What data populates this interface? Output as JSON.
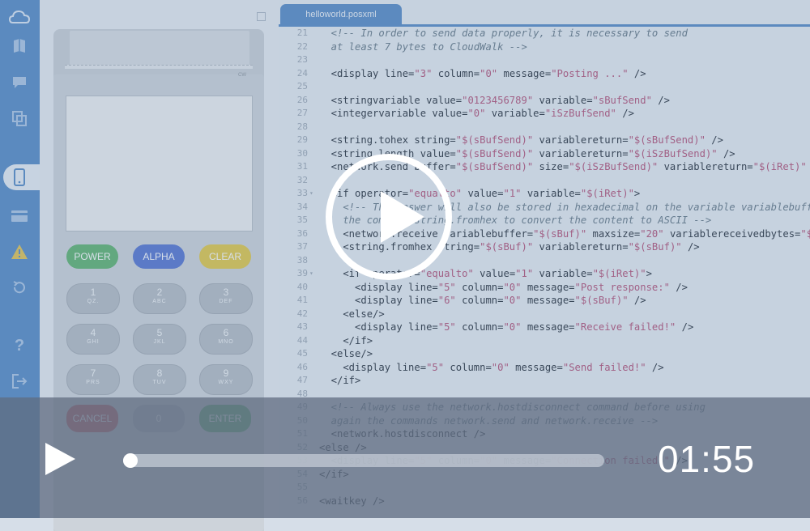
{
  "sidebar": {
    "icons": [
      "cloud-icon",
      "book-icon",
      "chat-icon",
      "copy-icon",
      "device-icon",
      "card-icon",
      "warning-icon",
      "history-icon",
      "help-icon",
      "logout-icon"
    ],
    "active": "device-icon",
    "color": "#4e86c4"
  },
  "terminal": {
    "brand": "CW",
    "function_keys": [
      {
        "label": "POWER",
        "color": "#58b069"
      },
      {
        "label": "ALPHA",
        "color": "#4e6fd0"
      },
      {
        "label": "CLEAR",
        "color": "#e3c73f"
      }
    ],
    "keypad": [
      {
        "digit": "1",
        "letters": "QZ."
      },
      {
        "digit": "2",
        "letters": "ABC"
      },
      {
        "digit": "3",
        "letters": "DEF"
      },
      {
        "digit": "4",
        "letters": "GHI"
      },
      {
        "digit": "5",
        "letters": "JKL"
      },
      {
        "digit": "6",
        "letters": "MNO"
      },
      {
        "digit": "7",
        "letters": "PRS"
      },
      {
        "digit": "8",
        "letters": "TUV"
      },
      {
        "digit": "9",
        "letters": "WXY"
      }
    ],
    "bottom_keys": [
      {
        "label": "CANCEL",
        "color": "#c8575c"
      },
      {
        "label": "0",
        "color": "#b4bbc3"
      },
      {
        "label": "ENTER",
        "color": "#58b069"
      }
    ]
  },
  "editor": {
    "tab_label": "helloworld.posxml",
    "lines": [
      {
        "n": "21",
        "t": "  <!-- In order to send data properly, it is necessary to send",
        "fold": ""
      },
      {
        "n": "22",
        "t": "  at least 7 bytes to CloudWalk -->",
        "fold": ""
      },
      {
        "n": "23",
        "t": "",
        "fold": ""
      },
      {
        "n": "24",
        "t": "  <display line=\"3\" column=\"0\" message=\"Posting ...\" />",
        "fold": ""
      },
      {
        "n": "25",
        "t": "",
        "fold": ""
      },
      {
        "n": "26",
        "t": "  <stringvariable value=\"0123456789\" variable=\"sBufSend\" />",
        "fold": ""
      },
      {
        "n": "27",
        "t": "  <integervariable value=\"0\" variable=\"iSzBufSend\" />",
        "fold": ""
      },
      {
        "n": "28",
        "t": "",
        "fold": ""
      },
      {
        "n": "29",
        "t": "  <string.tohex string=\"$(sBufSend)\" variablereturn=\"$(sBufSend)\" />",
        "fold": ""
      },
      {
        "n": "30",
        "t": "  <string.length value=\"$(sBufSend)\" variablereturn=\"$(iSzBufSend)\" />",
        "fold": ""
      },
      {
        "n": "31",
        "t": "  <network.send buffer=\"$(sBufSend)\" size=\"$(iSzBufSend)\" variablereturn=\"$(iRet)\" />",
        "fold": ""
      },
      {
        "n": "32",
        "t": "",
        "fold": ""
      },
      {
        "n": "33",
        "t": "  <if operator=\"equalto\" value=\"1\" variable=\"$(iRet)\">",
        "fold": "▾"
      },
      {
        "n": "34",
        "t": "    <!-- The answer will also be stored in hexadecimal on the variable variablebuffer, use",
        "fold": ""
      },
      {
        "n": "35",
        "t": "    the command string.fromhex to convert the content to ASCII -->",
        "fold": ""
      },
      {
        "n": "36",
        "t": "    <network.receive variablebuffer=\"$(sBuf)\" maxsize=\"20\" variablereceivedbytes=\"$(iRet)\" />",
        "fold": ""
      },
      {
        "n": "37",
        "t": "    <string.fromhex string=\"$(sBuf)\" variablereturn=\"$(sBuf)\" />",
        "fold": ""
      },
      {
        "n": "38",
        "t": "",
        "fold": ""
      },
      {
        "n": "39",
        "t": "    <if operator=\"equalto\" value=\"1\" variable=\"$(iRet)\">",
        "fold": "▾"
      },
      {
        "n": "40",
        "t": "      <display line=\"5\" column=\"0\" message=\"Post response:\" />",
        "fold": ""
      },
      {
        "n": "41",
        "t": "      <display line=\"6\" column=\"0\" message=\"$(sBuf)\" />",
        "fold": ""
      },
      {
        "n": "42",
        "t": "    <else/>",
        "fold": ""
      },
      {
        "n": "43",
        "t": "      <display line=\"5\" column=\"0\" message=\"Receive failed!\" />",
        "fold": ""
      },
      {
        "n": "44",
        "t": "    </if>",
        "fold": ""
      },
      {
        "n": "45",
        "t": "  <else/>",
        "fold": ""
      },
      {
        "n": "46",
        "t": "    <display line=\"5\" column=\"0\" message=\"Send failed!\" />",
        "fold": ""
      },
      {
        "n": "47",
        "t": "  </if>",
        "fold": ""
      },
      {
        "n": "48",
        "t": "",
        "fold": ""
      },
      {
        "n": "49",
        "t": "  <!-- Always use the network.hostdisconnect command before using",
        "fold": ""
      },
      {
        "n": "50",
        "t": "  again the commands network.send and network.receive -->",
        "fold": ""
      },
      {
        "n": "51",
        "t": "  <network.hostdisconnect />",
        "fold": ""
      },
      {
        "n": "52",
        "t": "<else />",
        "fold": ""
      },
      {
        "n": "53",
        "t": "  <display line=\"5\" column=\"0\" message=\"Connection failed!\" />",
        "fold": ""
      },
      {
        "n": "54",
        "t": "</if>",
        "fold": ""
      },
      {
        "n": "55",
        "t": "",
        "fold": ""
      },
      {
        "n": "56",
        "t": "<waitkey />",
        "fold": ""
      }
    ]
  },
  "player": {
    "time": "01:55",
    "progress": 0.0
  }
}
